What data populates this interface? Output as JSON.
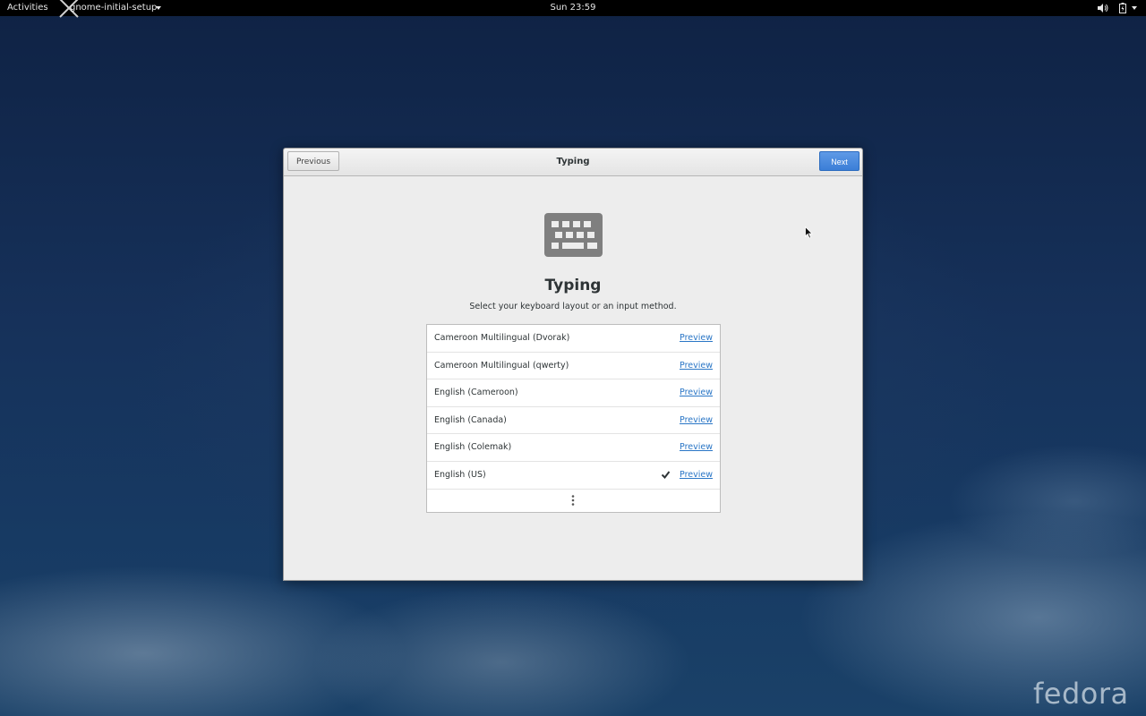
{
  "topbar": {
    "activities_label": "Activities",
    "app_name": "gnome-initial-setup",
    "clock": "Sun 23:59",
    "icons": [
      "x-logo-icon",
      "volume-icon",
      "battery-icon",
      "chevron-down-icon"
    ]
  },
  "window": {
    "title": "Typing",
    "previous_label": "Previous",
    "next_label": "Next",
    "accent_color": "#3b7ed7"
  },
  "page": {
    "icon": "keyboard-icon",
    "heading": "Typing",
    "subtitle": "Select your keyboard layout or an input method.",
    "layouts": [
      {
        "label": "Cameroon Multilingual (Dvorak)",
        "preview": "Preview",
        "selected": false
      },
      {
        "label": "Cameroon Multilingual (qwerty)",
        "preview": "Preview",
        "selected": false
      },
      {
        "label": "English (Cameroon)",
        "preview": "Preview",
        "selected": false
      },
      {
        "label": "English (Canada)",
        "preview": "Preview",
        "selected": false
      },
      {
        "label": "English (Colemak)",
        "preview": "Preview",
        "selected": false
      },
      {
        "label": "English (US)",
        "preview": "Preview",
        "selected": true
      }
    ],
    "more_icon": "more-vertical-icon"
  },
  "desktop": {
    "logo_text": "fedora"
  }
}
